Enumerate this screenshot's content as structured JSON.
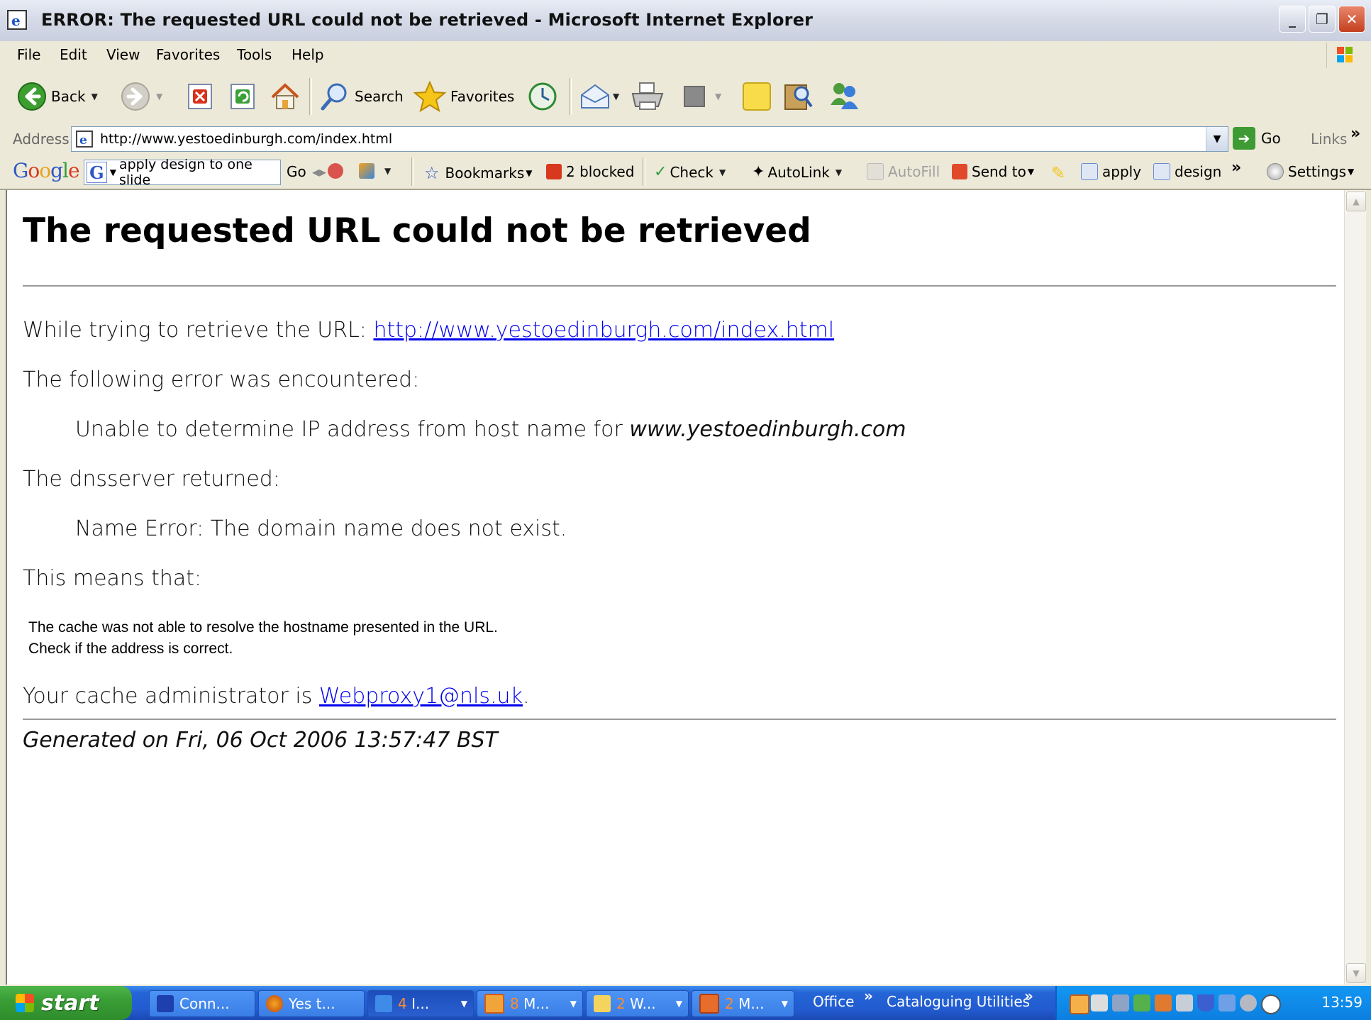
{
  "window": {
    "title": "ERROR: The requested URL could not be retrieved - Microsoft Internet Explorer",
    "minimize": "_",
    "restore": "❐",
    "close": "✕"
  },
  "menu": [
    "File",
    "Edit",
    "View",
    "Favorites",
    "Tools",
    "Help"
  ],
  "toolbar": {
    "back": "Back",
    "search": "Search",
    "favorites": "Favorites"
  },
  "address": {
    "label": "Address",
    "url": "http://www.yestoedinburgh.com/index.html",
    "go": "Go",
    "links": "Links"
  },
  "google_toolbar": {
    "logo": "Google",
    "search_text": "apply design to one slide",
    "go": "Go",
    "bookmarks": "Bookmarks",
    "blocked": "2 blocked",
    "check": "Check",
    "autolink": "AutoLink",
    "autofill": "AutoFill",
    "send_to": "Send to",
    "term1": "apply",
    "term2": "design",
    "settings": "Settings"
  },
  "page": {
    "heading": "The requested URL could not be retrieved",
    "retrieve_prefix": "While trying to retrieve the URL: ",
    "retrieve_url": "http://www.yestoedinburgh.com/index.html",
    "error_intro": "The following error was encountered:",
    "error_text": "Unable to determine IP address from host name for ",
    "error_host": "www.yestoedinburgh.com",
    "dns_intro": "The dnsserver returned:",
    "dns_text": "Name Error: The domain name does not exist.",
    "means": "This means that:",
    "means_line1": "The cache was not able to resolve the hostname presented in the URL.",
    "means_line2": "Check if the address is correct.",
    "admin_prefix": "Your cache administrator is ",
    "admin_email": "Webproxy1@nls.uk",
    "admin_suffix": ".",
    "generated": "Generated on Fri, 06 Oct 2006 13:57:47 BST"
  },
  "taskbar": {
    "start": "start",
    "buttons": [
      {
        "label": "Conn...",
        "count": ""
      },
      {
        "label": "Yes t...",
        "count": ""
      },
      {
        "label": "I...",
        "count": "4"
      },
      {
        "label": "M...",
        "count": "8"
      },
      {
        "label": "W...",
        "count": "2"
      },
      {
        "label": "M...",
        "count": "2"
      }
    ],
    "quicklaunch": [
      "Office",
      "Cataloguing Utilities"
    ],
    "clock": "13:59"
  }
}
